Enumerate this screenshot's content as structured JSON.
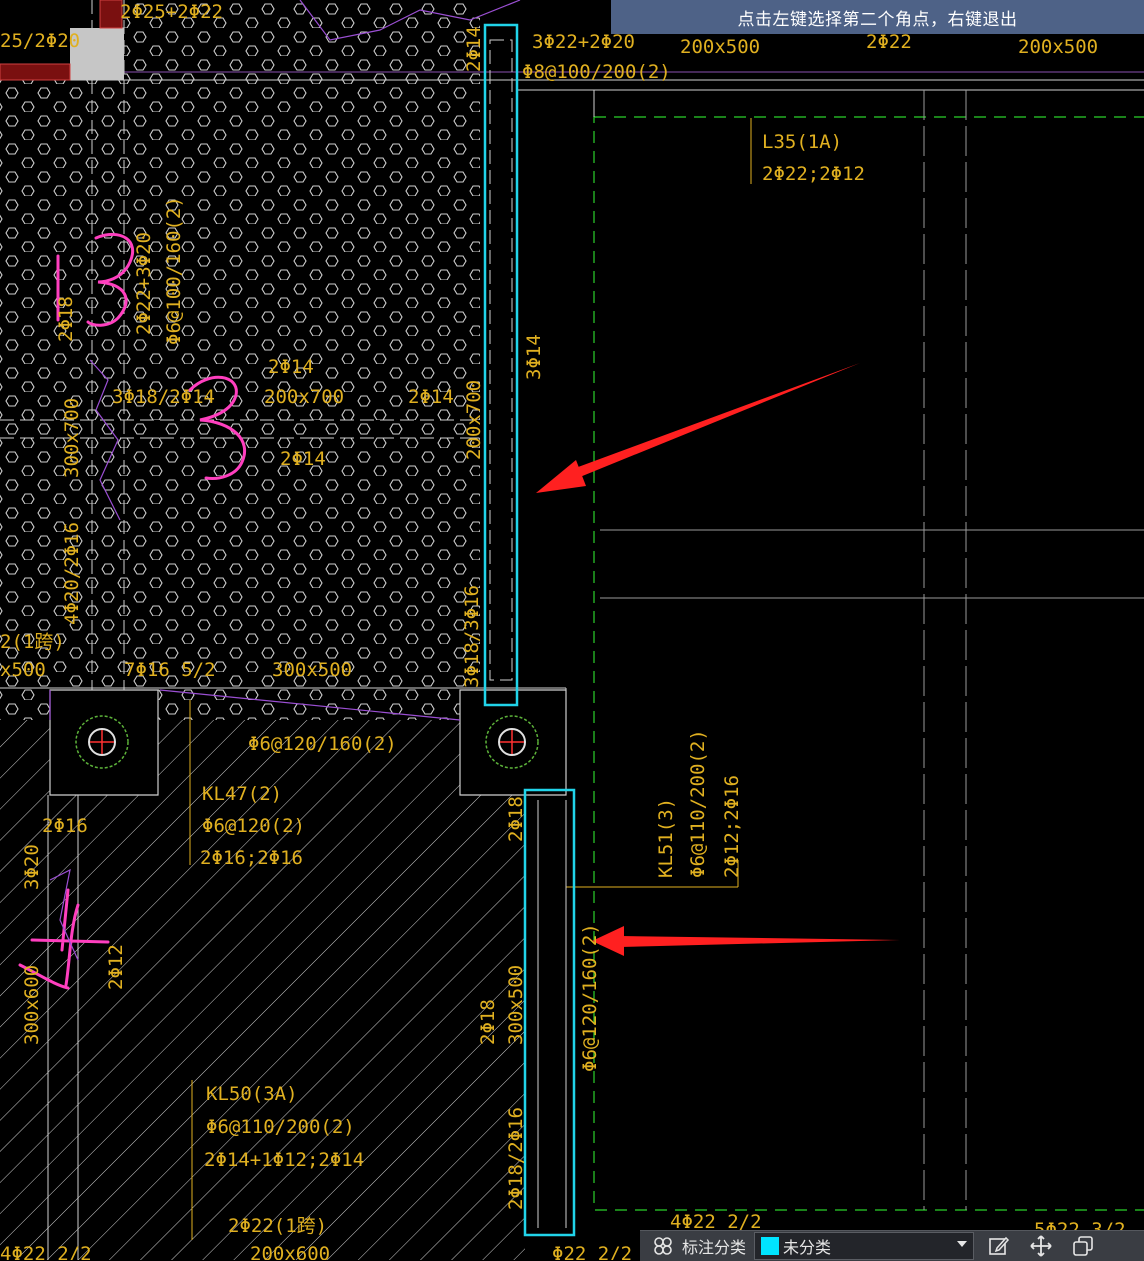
{
  "hint": {
    "text": "点击左键选择第二个角点，右键退出"
  },
  "toolbar": {
    "label": "标注分类",
    "select_value": "未分类",
    "swatch_color": "#00e5ff",
    "icons": [
      "layers-icon",
      "edit-icon",
      "move-icon",
      "copy-icon"
    ]
  },
  "colors": {
    "text": "#e0b020",
    "highlight": "#21d4ea",
    "arrow": "#ff2020",
    "markup": "#ff3fbf",
    "slab_dashed": "#2bd12b"
  },
  "labels": {
    "t01": "2Φ25+2Φ22",
    "t02": "25/2Φ20",
    "t03": "3Φ22+2Φ20",
    "t04": "Φ8@100/200(2)",
    "t05": "200x500",
    "t06": "2Φ22",
    "t07": "200x500",
    "t08": "2Φ14",
    "t09": "L35(1A)",
    "t10": "2Φ22;2Φ12",
    "t11": "2Φ22+3Φ20",
    "t12": "Φ6@100/160(2)",
    "t13": "2Φ18",
    "t14": "3Φ14",
    "t15": "2Φ14",
    "t16": "200x700",
    "t17": "2Φ14",
    "t18": "3Φ18/2Φ14",
    "t19": "300x700",
    "t20": "2Φ14",
    "t21": "200x700",
    "t22": "4Φ20/2Φ16",
    "t23": "3Φ18/3Φ16",
    "t24": "2(1跨)",
    "t25": "x500",
    "t26": "7Φ16 5/2",
    "t27": "300x500",
    "t28": "Φ6@120/160(2)",
    "t29": "KL47(2)",
    "t30": "Φ6@120(2)",
    "t31": "2Φ16;2Φ16",
    "t32": "2Φ16",
    "t33": "3Φ20",
    "t34": "2Φ18",
    "t35": "KL51(3)",
    "t36": "Φ6@110/200(2)",
    "t37": "2Φ12;2Φ16",
    "t38": "2Φ12",
    "t39": "300x600",
    "t40": "2Φ18",
    "t41": "300x500",
    "t42": "Φ6@120/160(2)",
    "t43": "KL50(3A)",
    "t44": "Φ6@110/200(2)",
    "t45": "2Φ14+1Φ12;2Φ14",
    "t46": "2Φ18/2Φ16",
    "t47": "2Φ22(1跨)",
    "t48": "4Φ22 2/2",
    "t49": "200x600",
    "t50": "5Φ22 3/2",
    "t51": "Φ22 2/2",
    "t52": "4Φ22 2/2"
  },
  "markup_numbers": [
    "3",
    "3",
    "4"
  ]
}
